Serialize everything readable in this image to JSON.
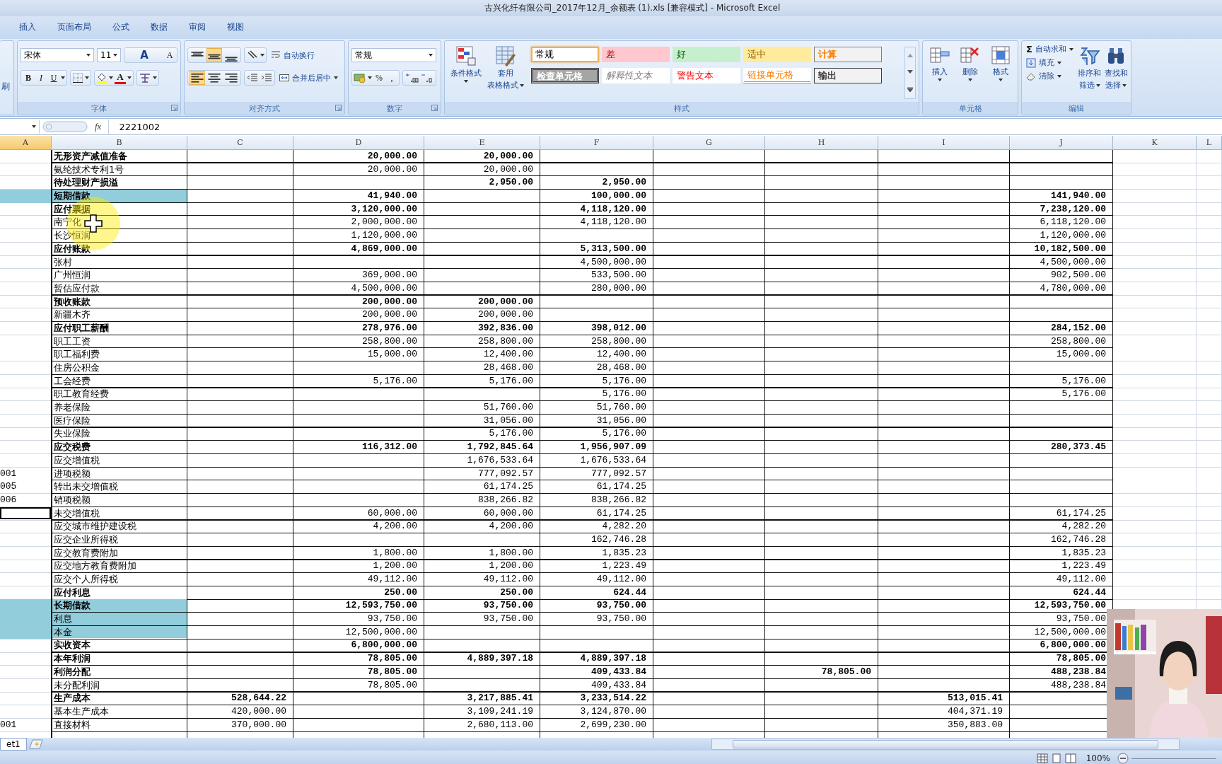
{
  "window": {
    "title": "古兴化纤有限公司_2017年12月_余额表 (1).xls  [兼容模式] - Microsoft Excel"
  },
  "ribbon_tabs": [
    {
      "label": "插入",
      "selected": false
    },
    {
      "label": "页面布局",
      "selected": false
    },
    {
      "label": "公式",
      "selected": false
    },
    {
      "label": "数据",
      "selected": false
    },
    {
      "label": "审阅",
      "selected": false
    },
    {
      "label": "视图",
      "selected": false
    }
  ],
  "ribbon": {
    "left_cut_label": "刷",
    "font": {
      "name": "宋体",
      "size": "11",
      "size_buttons": [
        "A",
        "A"
      ],
      "style_buttons": [
        "B",
        "I",
        "U"
      ],
      "color_button": "A",
      "group_label": "字体"
    },
    "alignment": {
      "vertical": [
        {
          "kind": "top",
          "selected": false
        },
        {
          "kind": "middle",
          "selected": true
        },
        {
          "kind": "bottom",
          "selected": false
        }
      ],
      "horizontal": [
        {
          "kind": "left",
          "selected": true
        },
        {
          "kind": "center",
          "selected": false
        },
        {
          "kind": "right",
          "selected": false
        }
      ],
      "wrap": "自动换行",
      "merge": "合并后居中",
      "group_label": "对齐方式"
    },
    "number": {
      "format": "常规",
      "buttons": [
        "%",
        ","
      ],
      "group_label": "数字"
    },
    "styles": {
      "conditional": "条件格式",
      "table_format": [
        "套用",
        "表格格式"
      ],
      "group_label": "样式",
      "cell_styles": [
        {
          "label": "常规",
          "kind": "normal",
          "selected": true
        },
        {
          "label": "差",
          "kind": "bad",
          "selected": false
        },
        {
          "label": "好",
          "kind": "good",
          "selected": false
        },
        {
          "label": "适中",
          "kind": "neutral",
          "selected": false
        },
        {
          "label": "计算",
          "kind": "calculation",
          "selected": false
        },
        {
          "label": "检查单元格",
          "kind": "check",
          "selected": false
        },
        {
          "label": "解释性文本",
          "kind": "explanatory",
          "selected": false
        },
        {
          "label": "警告文本",
          "kind": "warning",
          "selected": false
        },
        {
          "label": "链接单元格",
          "kind": "linked",
          "selected": false
        },
        {
          "label": "输出",
          "kind": "output",
          "selected": false
        }
      ]
    },
    "cells": {
      "buttons": [
        {
          "label": "插入",
          "kind": "insert"
        },
        {
          "label": "删除",
          "kind": "delete"
        },
        {
          "label": "格式",
          "kind": "format"
        }
      ],
      "group_label": "单元格"
    },
    "editing": {
      "autosum_symbol": "Σ",
      "items": [
        {
          "label": "自动求和",
          "kind": "autosum"
        },
        {
          "label": "填充",
          "kind": "fill"
        },
        {
          "label": "清除",
          "kind": "clear"
        }
      ],
      "sort": [
        "排序和",
        "筛选"
      ],
      "find": [
        "查找和",
        "选择"
      ],
      "group_label": "编辑"
    }
  },
  "formula_bar": {
    "fx": "fx",
    "value": "2221002"
  },
  "columns": [
    {
      "label": "A",
      "selected": true
    },
    {
      "label": "B",
      "selected": false
    },
    {
      "label": "C",
      "selected": false
    },
    {
      "label": "D",
      "selected": false
    },
    {
      "label": "E",
      "selected": false
    },
    {
      "label": "F",
      "selected": false
    },
    {
      "label": "G",
      "selected": false
    },
    {
      "label": "H",
      "selected": false
    },
    {
      "label": "I",
      "selected": false
    },
    {
      "label": "J",
      "selected": false
    },
    {
      "label": "K",
      "selected": false
    },
    {
      "label": "L",
      "selected": false
    }
  ],
  "rows": [
    {
      "b": "无形资产减值准备",
      "d": "20,000.00",
      "e": "20,000.00",
      "kind": "total",
      "highlighted": false,
      "selected": false
    },
    {
      "b": "氨纶技术专利1号",
      "d": "20,000.00",
      "e": "20,000.00",
      "kind": "detail",
      "highlighted": false,
      "selected": false
    },
    {
      "b": "待处理财产损溢",
      "e": "2,950.00",
      "f": "2,950.00",
      "kind": "total",
      "highlighted": false,
      "selected": false
    },
    {
      "b": "短期借款",
      "d": "41,940.00",
      "f": "100,000.00",
      "j": "141,940.00",
      "kind": "total",
      "highlighted": true,
      "selected": false
    },
    {
      "b": "应付票据",
      "d": "3,120,000.00",
      "f": "4,118,120.00",
      "j": "7,238,120.00",
      "kind": "total",
      "highlighted": false,
      "selected": false
    },
    {
      "b": "南宁化",
      "d": "2,000,000.00",
      "f": "4,118,120.00",
      "j": "6,118,120.00",
      "kind": "detail",
      "highlighted": false,
      "selected": false
    },
    {
      "b": "长沙恒润",
      "d": "1,120,000.00",
      "j": "1,120,000.00",
      "kind": "detail",
      "highlighted": false,
      "selected": false
    },
    {
      "b": "应付账款",
      "d": "4,869,000.00",
      "f": "5,313,500.00",
      "j": "10,182,500.00",
      "kind": "total",
      "highlighted": false,
      "selected": false
    },
    {
      "b": "张村",
      "f": "4,500,000.00",
      "j": "4,500,000.00",
      "kind": "detail",
      "highlighted": false,
      "selected": false
    },
    {
      "b": "广州恒润",
      "d": "369,000.00",
      "f": "533,500.00",
      "j": "902,500.00",
      "kind": "detail",
      "highlighted": false,
      "selected": false
    },
    {
      "b": "暂估应付款",
      "d": "4,500,000.00",
      "f": "280,000.00",
      "j": "4,780,000.00",
      "kind": "detail",
      "highlighted": false,
      "selected": false
    },
    {
      "b": "预收账款",
      "d": "200,000.00",
      "e": "200,000.00",
      "kind": "total",
      "highlighted": false,
      "selected": false
    },
    {
      "b": "新疆木齐",
      "d": "200,000.00",
      "e": "200,000.00",
      "kind": "detail",
      "highlighted": false,
      "selected": false
    },
    {
      "b": "应付职工薪酬",
      "d": "278,976.00",
      "e": "392,836.00",
      "f": "398,012.00",
      "j": "284,152.00",
      "kind": "total",
      "highlighted": false,
      "selected": false
    },
    {
      "b": "职工工资",
      "d": "258,800.00",
      "e": "258,800.00",
      "f": "258,800.00",
      "j": "258,800.00",
      "kind": "detail",
      "highlighted": false,
      "selected": false
    },
    {
      "b": "职工福利费",
      "d": "15,000.00",
      "e": "12,400.00",
      "f": "12,400.00",
      "j": "15,000.00",
      "kind": "detail",
      "highlighted": false,
      "selected": false
    },
    {
      "b": "住房公积金",
      "e": "28,468.00",
      "f": "28,468.00",
      "kind": "detail",
      "highlighted": false,
      "selected": false
    },
    {
      "b": "工会经费",
      "d": "5,176.00",
      "e": "5,176.00",
      "f": "5,176.00",
      "j": "5,176.00",
      "kind": "detail",
      "highlighted": false,
      "selected": false
    },
    {
      "b": "职工教育经费",
      "f": "5,176.00",
      "j": "5,176.00",
      "kind": "detail",
      "highlighted": false,
      "selected": false
    },
    {
      "b": "养老保险",
      "e": "51,760.00",
      "f": "51,760.00",
      "kind": "detail",
      "highlighted": false,
      "selected": false
    },
    {
      "b": "医疗保险",
      "e": "31,056.00",
      "f": "31,056.00",
      "kind": "detail",
      "highlighted": false,
      "selected": false
    },
    {
      "b": "失业保险",
      "e": "5,176.00",
      "f": "5,176.00",
      "kind": "detail",
      "highlighted": false,
      "selected": false
    },
    {
      "b": "应交税费",
      "d": "116,312.00",
      "e": "1,792,845.64",
      "f": "1,956,907.09",
      "j": "280,373.45",
      "kind": "total",
      "highlighted": false,
      "selected": false
    },
    {
      "b": "应交增值税",
      "e": "1,676,533.64",
      "f": "1,676,533.64",
      "kind": "detail",
      "highlighted": false,
      "selected": false
    },
    {
      "a": "001",
      "b": "进项税额",
      "e": "777,092.57",
      "f": "777,092.57",
      "kind": "detail",
      "highlighted": false,
      "selected": false
    },
    {
      "a": "005",
      "b": "转出未交增值税",
      "e": "61,174.25",
      "f": "61,174.25",
      "kind": "detail",
      "highlighted": false,
      "selected": false
    },
    {
      "a": "006",
      "b": "销项税额",
      "e": "838,266.82",
      "f": "838,266.82",
      "kind": "detail",
      "highlighted": false,
      "selected": false
    },
    {
      "b": "未交增值税",
      "d": "60,000.00",
      "e": "60,000.00",
      "f": "61,174.25",
      "j": "61,174.25",
      "kind": "detail",
      "highlighted": false,
      "selected": true
    },
    {
      "b": "应交城市维护建设税",
      "d": "4,200.00",
      "e": "4,200.00",
      "f": "4,282.20",
      "j": "4,282.20",
      "kind": "detail",
      "highlighted": false,
      "selected": false
    },
    {
      "b": "应交企业所得税",
      "f": "162,746.28",
      "j": "162,746.28",
      "kind": "detail",
      "highlighted": false,
      "selected": false
    },
    {
      "b": "应交教育费附加",
      "d": "1,800.00",
      "e": "1,800.00",
      "f": "1,835.23",
      "j": "1,835.23",
      "kind": "detail",
      "highlighted": false,
      "selected": false
    },
    {
      "b": "应交地方教育费附加",
      "d": "1,200.00",
      "e": "1,200.00",
      "f": "1,223.49",
      "j": "1,223.49",
      "kind": "detail",
      "highlighted": false,
      "selected": false
    },
    {
      "b": "应交个人所得税",
      "d": "49,112.00",
      "e": "49,112.00",
      "f": "49,112.00",
      "j": "49,112.00",
      "kind": "detail",
      "highlighted": false,
      "selected": false
    },
    {
      "b": "应付利息",
      "d": "250.00",
      "e": "250.00",
      "f": "624.44",
      "j": "624.44",
      "kind": "total",
      "highlighted": false,
      "selected": false
    },
    {
      "b": "长期借款",
      "d": "12,593,750.00",
      "e": "93,750.00",
      "f": "93,750.00",
      "j": "12,593,750.00",
      "kind": "total",
      "highlighted": true,
      "selected": false
    },
    {
      "b": "利息",
      "d": "93,750.00",
      "e": "93,750.00",
      "f": "93,750.00",
      "j": "93,750.00",
      "kind": "detail",
      "highlighted": true,
      "selected": false
    },
    {
      "b": "本金",
      "d": "12,500,000.00",
      "j": "12,500,000.00",
      "kind": "detail",
      "highlighted": true,
      "selected": false
    },
    {
      "b": "实收资本",
      "d": "6,800,000.00",
      "j": "6,800,000.00",
      "kind": "total",
      "highlighted": false,
      "selected": false
    },
    {
      "b": "本年利润",
      "d": "78,805.00",
      "e": "4,889,397.18",
      "f": "4,889,397.18",
      "j": "78,805.00",
      "kind": "total",
      "highlighted": false,
      "selected": false
    },
    {
      "b": "利润分配",
      "d": "78,805.00",
      "f": "409,433.84",
      "h": "78,805.00",
      "j": "488,238.84",
      "kind": "total",
      "highlighted": false,
      "selected": false
    },
    {
      "b": "未分配利润",
      "d": "78,805.00",
      "f": "409,433.84",
      "j": "488,238.84",
      "kind": "detail",
      "highlighted": false,
      "selected": false
    },
    {
      "b": "生产成本",
      "c": "528,644.22",
      "e": "3,217,885.41",
      "f": "3,233,514.22",
      "i": "513,015.41",
      "kind": "total",
      "highlighted": false,
      "selected": false
    },
    {
      "b": "基本生产成本",
      "c": "420,000.00",
      "e": "3,109,241.19",
      "f": "3,124,870.00",
      "i": "404,371.19",
      "kind": "detail",
      "highlighted": false,
      "selected": false
    },
    {
      "a": "001",
      "b": "直接材料",
      "c": "370,000.00",
      "e": "2,680,113.00",
      "f": "2,699,230.00",
      "i": "350,883.00",
      "kind": "detail",
      "highlighted": false,
      "selected": false
    }
  ],
  "sheet_tab": {
    "label": "et1"
  },
  "status_bar": {
    "zoom": "100%"
  }
}
